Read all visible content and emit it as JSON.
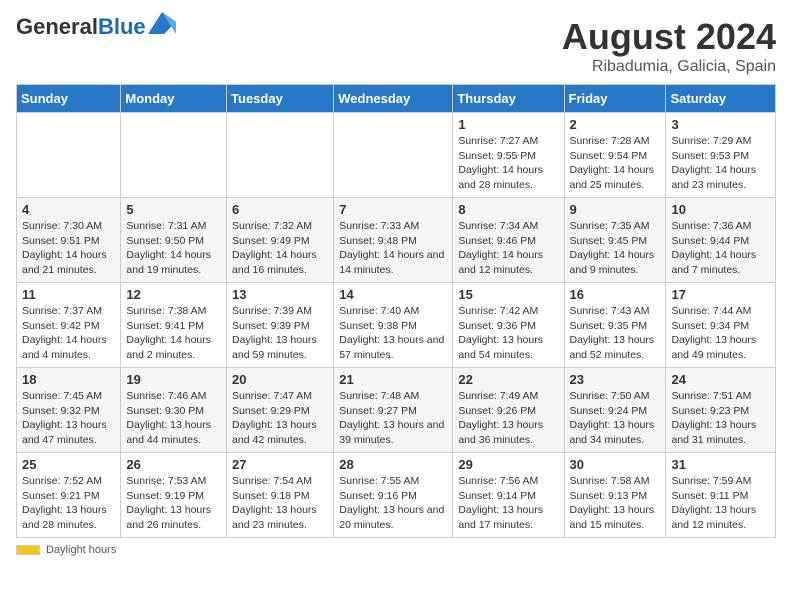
{
  "header": {
    "logo_general": "General",
    "logo_blue": "Blue",
    "title": "August 2024",
    "subtitle": "Ribadumia, Galicia, Spain"
  },
  "calendar": {
    "weekdays": [
      "Sunday",
      "Monday",
      "Tuesday",
      "Wednesday",
      "Thursday",
      "Friday",
      "Saturday"
    ],
    "weeks": [
      [
        {
          "day": "",
          "info": ""
        },
        {
          "day": "",
          "info": ""
        },
        {
          "day": "",
          "info": ""
        },
        {
          "day": "",
          "info": ""
        },
        {
          "day": "1",
          "info": "Sunrise: 7:27 AM\nSunset: 9:55 PM\nDaylight: 14 hours and 28 minutes."
        },
        {
          "day": "2",
          "info": "Sunrise: 7:28 AM\nSunset: 9:54 PM\nDaylight: 14 hours and 25 minutes."
        },
        {
          "day": "3",
          "info": "Sunrise: 7:29 AM\nSunset: 9:53 PM\nDaylight: 14 hours and 23 minutes."
        }
      ],
      [
        {
          "day": "4",
          "info": "Sunrise: 7:30 AM\nSunset: 9:51 PM\nDaylight: 14 hours and 21 minutes."
        },
        {
          "day": "5",
          "info": "Sunrise: 7:31 AM\nSunset: 9:50 PM\nDaylight: 14 hours and 19 minutes."
        },
        {
          "day": "6",
          "info": "Sunrise: 7:32 AM\nSunset: 9:49 PM\nDaylight: 14 hours and 16 minutes."
        },
        {
          "day": "7",
          "info": "Sunrise: 7:33 AM\nSunset: 9:48 PM\nDaylight: 14 hours and 14 minutes."
        },
        {
          "day": "8",
          "info": "Sunrise: 7:34 AM\nSunset: 9:46 PM\nDaylight: 14 hours and 12 minutes."
        },
        {
          "day": "9",
          "info": "Sunrise: 7:35 AM\nSunset: 9:45 PM\nDaylight: 14 hours and 9 minutes."
        },
        {
          "day": "10",
          "info": "Sunrise: 7:36 AM\nSunset: 9:44 PM\nDaylight: 14 hours and 7 minutes."
        }
      ],
      [
        {
          "day": "11",
          "info": "Sunrise: 7:37 AM\nSunset: 9:42 PM\nDaylight: 14 hours and 4 minutes."
        },
        {
          "day": "12",
          "info": "Sunrise: 7:38 AM\nSunset: 9:41 PM\nDaylight: 14 hours and 2 minutes."
        },
        {
          "day": "13",
          "info": "Sunrise: 7:39 AM\nSunset: 9:39 PM\nDaylight: 13 hours and 59 minutes."
        },
        {
          "day": "14",
          "info": "Sunrise: 7:40 AM\nSunset: 9:38 PM\nDaylight: 13 hours and 57 minutes."
        },
        {
          "day": "15",
          "info": "Sunrise: 7:42 AM\nSunset: 9:36 PM\nDaylight: 13 hours and 54 minutes."
        },
        {
          "day": "16",
          "info": "Sunrise: 7:43 AM\nSunset: 9:35 PM\nDaylight: 13 hours and 52 minutes."
        },
        {
          "day": "17",
          "info": "Sunrise: 7:44 AM\nSunset: 9:34 PM\nDaylight: 13 hours and 49 minutes."
        }
      ],
      [
        {
          "day": "18",
          "info": "Sunrise: 7:45 AM\nSunset: 9:32 PM\nDaylight: 13 hours and 47 minutes."
        },
        {
          "day": "19",
          "info": "Sunrise: 7:46 AM\nSunset: 9:30 PM\nDaylight: 13 hours and 44 minutes."
        },
        {
          "day": "20",
          "info": "Sunrise: 7:47 AM\nSunset: 9:29 PM\nDaylight: 13 hours and 42 minutes."
        },
        {
          "day": "21",
          "info": "Sunrise: 7:48 AM\nSunset: 9:27 PM\nDaylight: 13 hours and 39 minutes."
        },
        {
          "day": "22",
          "info": "Sunrise: 7:49 AM\nSunset: 9:26 PM\nDaylight: 13 hours and 36 minutes."
        },
        {
          "day": "23",
          "info": "Sunrise: 7:50 AM\nSunset: 9:24 PM\nDaylight: 13 hours and 34 minutes."
        },
        {
          "day": "24",
          "info": "Sunrise: 7:51 AM\nSunset: 9:23 PM\nDaylight: 13 hours and 31 minutes."
        }
      ],
      [
        {
          "day": "25",
          "info": "Sunrise: 7:52 AM\nSunset: 9:21 PM\nDaylight: 13 hours and 28 minutes."
        },
        {
          "day": "26",
          "info": "Sunrise: 7:53 AM\nSunset: 9:19 PM\nDaylight: 13 hours and 26 minutes."
        },
        {
          "day": "27",
          "info": "Sunrise: 7:54 AM\nSunset: 9:18 PM\nDaylight: 13 hours and 23 minutes."
        },
        {
          "day": "28",
          "info": "Sunrise: 7:55 AM\nSunset: 9:16 PM\nDaylight: 13 hours and 20 minutes."
        },
        {
          "day": "29",
          "info": "Sunrise: 7:56 AM\nSunset: 9:14 PM\nDaylight: 13 hours and 17 minutes."
        },
        {
          "day": "30",
          "info": "Sunrise: 7:58 AM\nSunset: 9:13 PM\nDaylight: 13 hours and 15 minutes."
        },
        {
          "day": "31",
          "info": "Sunrise: 7:59 AM\nSunset: 9:11 PM\nDaylight: 13 hours and 12 minutes."
        }
      ]
    ]
  },
  "footer": {
    "daylight_label": "Daylight hours"
  }
}
